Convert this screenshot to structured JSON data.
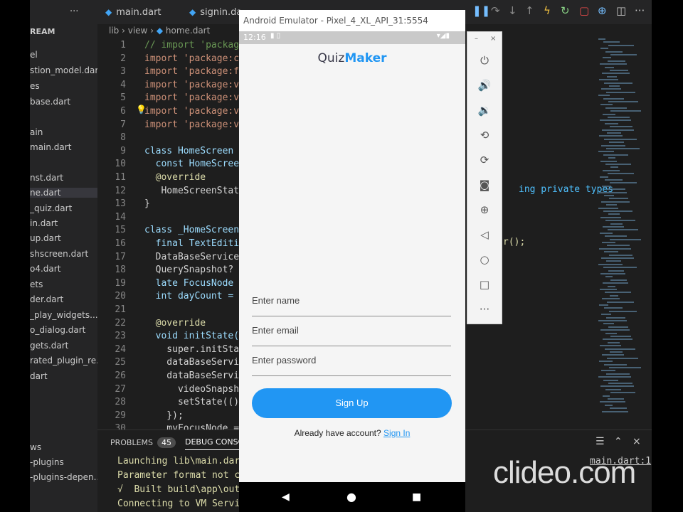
{
  "ide": {
    "tabs": [
      "main.dart",
      "signin.da",
      "home.dart"
    ],
    "breadcrumb": [
      "lib",
      "view",
      "home.dart"
    ],
    "sidebar_title": "REAM",
    "sidebar_items": [
      "el",
      "stion_model.dart",
      "es",
      "base.dart",
      "",
      "ain",
      "main.dart",
      "",
      "nst.dart",
      "ne.dart",
      "_quiz.dart",
      "in.dart",
      "up.dart",
      "shscreen.dart",
      "o4.dart",
      "ets",
      "der.dart",
      "_play_widgets....",
      "o_dialog.dart",
      "gets.dart",
      "rated_plugin_re...",
      "dart",
      "",
      "",
      "",
      "ws",
      "-plugins",
      "-plugins-depen..."
    ],
    "line_numbers": [
      "1",
      "2",
      "3",
      "4",
      "5",
      "6",
      "7",
      "8",
      "9",
      "10",
      "11",
      "12",
      "13",
      "14",
      "15",
      "16",
      "17",
      "18",
      "19",
      "20",
      "21",
      "22",
      "23",
      "24",
      "25",
      "26",
      "27",
      "28",
      "29",
      "30"
    ],
    "code_lines": [
      "// import 'package",
      "import 'package:cl",
      "import 'package:fl",
      "import 'package:vi",
      "import 'package:vi",
      "import 'package:vi",
      "import 'package:vi",
      "",
      "class HomeScreen e",
      "  const HomeScreen",
      "  @override",
      "   HomeScreenState",
      "}",
      "",
      "class _HomeScreenS",
      "  final TextEditin",
      "  DataBaseServices",
      "  QuerySnapshot? v",
      "  late FocusNode m",
      "  int dayCount = 0",
      "",
      "  @override",
      "  void initState()",
      "    super.initStat",
      "    dataBaseServic",
      "    dataBaseServic",
      "      videoSnapsho",
      "      setState(()",
      "    });",
      "    myFocusNode ="
    ],
    "code_overflow_1": "ing private types",
    "code_overflow_2": "r();",
    "panel": {
      "problems_label": "PROBLEMS",
      "problems_count": "45",
      "debug_label": "DEBUG CONSO",
      "lines": [
        "Launching lib\\main.dart",
        "Parameter format not co",
        "√  Built build\\app\\outp",
        "Connecting to VM Servic"
      ],
      "file_link": "main.dart:1"
    }
  },
  "emulator": {
    "window_title": "Android Emulator - Pixel_4_XL_API_31:5554",
    "close": "×",
    "status_time": "12:16",
    "app_title_part1": "Quiz",
    "app_title_part2": "Maker",
    "name_placeholder": "Enter name",
    "email_placeholder": "Enter email",
    "password_placeholder": "Enter password",
    "signup_label": "Sign Up",
    "have_account": "Already have account?",
    "signin_link": "Sign In",
    "toolbar_min": "–",
    "toolbar_close": "×"
  },
  "watermark": "clideo.com",
  "colors": {
    "accent": "#2196f3",
    "title_dark": "#3a3a4a",
    "editor_bg": "#1e1e1e"
  }
}
